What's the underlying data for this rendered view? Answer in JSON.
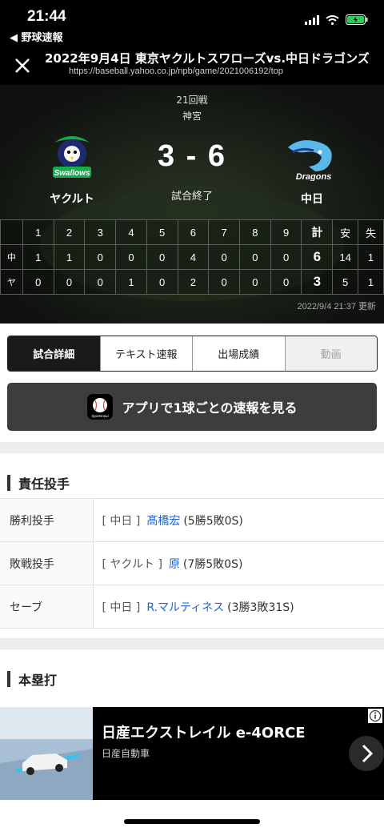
{
  "status_bar": {
    "time": "21:44",
    "back_app": "◀ 野球速報",
    "battery_color": "#34c759"
  },
  "header": {
    "title": "2022年9月4日 東京ヤクルトスワローズvs.中日ドラゴンズ",
    "url": "https://baseball.yahoo.co.jp/npb/game/2021006192/top"
  },
  "game": {
    "round": "21回戦",
    "venue": "神宮",
    "score": "3 - 6",
    "status": "試合終了",
    "away_team": "ヤクルト",
    "home_team": "中日",
    "updated": "2022/9/4 21:37 更新"
  },
  "linescore": {
    "header": [
      "",
      "1",
      "2",
      "3",
      "4",
      "5",
      "6",
      "7",
      "8",
      "9",
      "計",
      "安",
      "失"
    ],
    "rows": [
      [
        "中",
        "1",
        "1",
        "0",
        "0",
        "0",
        "4",
        "0",
        "0",
        "0",
        "6",
        "14",
        "1"
      ],
      [
        "ヤ",
        "0",
        "0",
        "0",
        "1",
        "0",
        "2",
        "0",
        "0",
        "0",
        "3",
        "5",
        "1"
      ]
    ]
  },
  "tabs": [
    "試合詳細",
    "テキスト速報",
    "出場成績",
    "動画"
  ],
  "app_button": {
    "label": "アプリで1球ごとの速報を見る",
    "icon_text": "Sportsnavi"
  },
  "sections": {
    "pitchers_title": "責任投手",
    "homerun_title": "本塁打"
  },
  "pitchers": [
    {
      "role": "勝利投手",
      "team": "[ 中日 ]",
      "name": "髙橋宏",
      "record": "(5勝5敗0S)"
    },
    {
      "role": "敗戦投手",
      "team": "[ ヤクルト ]",
      "name": "原",
      "record": "(7勝5敗0S)"
    },
    {
      "role": "セーブ",
      "team": "[ 中日 ]",
      "name": "R.マルティネス",
      "record": "(3勝3敗31S)"
    }
  ],
  "ad": {
    "title": "日産エクストレイル e-4ORCE",
    "sponsor": "日産自動車"
  }
}
